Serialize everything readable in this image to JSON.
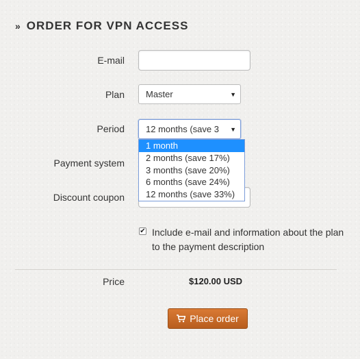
{
  "heading": "ORDER FOR VPN ACCESS",
  "fields": {
    "email": {
      "label": "E-mail",
      "value": ""
    },
    "plan": {
      "label": "Plan",
      "value": "Master"
    },
    "period": {
      "label": "Period",
      "value": "12 months (save 3"
    },
    "payment": {
      "label": "Payment system"
    },
    "coupon": {
      "label": "Discount coupon",
      "value": ""
    }
  },
  "period_options": [
    "1 month",
    "2 months (save 17%)",
    "3 months (save 20%)",
    "6 months (save 24%)",
    "12 months (save 33%)"
  ],
  "highlighted_option": "1 month",
  "checkbox": {
    "checked": true,
    "label": "Include e-mail and information about the plan to the payment description"
  },
  "price": {
    "label": "Price",
    "value": "$120.00 USD"
  },
  "button": {
    "label": "Place order"
  },
  "colors": {
    "button": "#c96a27",
    "highlight": "#1e90ff"
  }
}
